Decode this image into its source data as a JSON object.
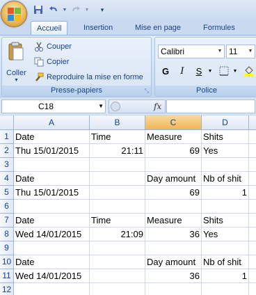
{
  "quick_access": {
    "icons": [
      "office-logo",
      "save-icon",
      "undo-icon",
      "redo-icon",
      "customize-icon"
    ]
  },
  "tabs": [
    {
      "label": "Accueil",
      "active": true
    },
    {
      "label": "Insertion",
      "active": false
    },
    {
      "label": "Mise en page",
      "active": false
    },
    {
      "label": "Formules",
      "active": false
    }
  ],
  "ribbon": {
    "clipboard": {
      "paste_label": "Coller",
      "cut_label": "Couper",
      "copy_label": "Copier",
      "format_painter_label": "Reproduire la mise en forme",
      "group_label": "Presse-papiers"
    },
    "font": {
      "font_name": "Calibri",
      "font_size": "11",
      "bold": "G",
      "italic": "I",
      "underline": "S",
      "group_label": "Police"
    }
  },
  "formula_bar": {
    "name_box": "C18",
    "fx_label": "fx",
    "formula": ""
  },
  "sheet": {
    "columns": [
      "A",
      "B",
      "C",
      "D"
    ],
    "selected_column": "C",
    "rows": [
      "1",
      "2",
      "3",
      "4",
      "5",
      "6",
      "7",
      "8",
      "9",
      "10",
      "11",
      "12"
    ],
    "cells": [
      [
        "Date",
        "Time",
        "Measure",
        "Shits"
      ],
      [
        "Thu 15/01/2015",
        "21:11",
        "69",
        "Yes"
      ],
      [
        "",
        "",
        "",
        ""
      ],
      [
        "Date",
        "",
        "Day amount",
        "Nb of shit"
      ],
      [
        "Thu 15/01/2015",
        "",
        "69",
        "1"
      ],
      [
        "",
        "",
        "",
        ""
      ],
      [
        "Date",
        "Time",
        "Measure",
        "Shits"
      ],
      [
        "Wed 14/01/2015",
        "21:09",
        "36",
        "Yes"
      ],
      [
        "",
        "",
        "",
        ""
      ],
      [
        "Date",
        "",
        "Day amount",
        "Nb of shit"
      ],
      [
        "Wed 14/01/2015",
        "",
        "36",
        "1"
      ],
      [
        "",
        "",
        "",
        ""
      ]
    ]
  },
  "colors": {
    "ribbon_blue": "#c5d6ec",
    "header_text": "#15428b",
    "selected_header": "#f1b553"
  }
}
